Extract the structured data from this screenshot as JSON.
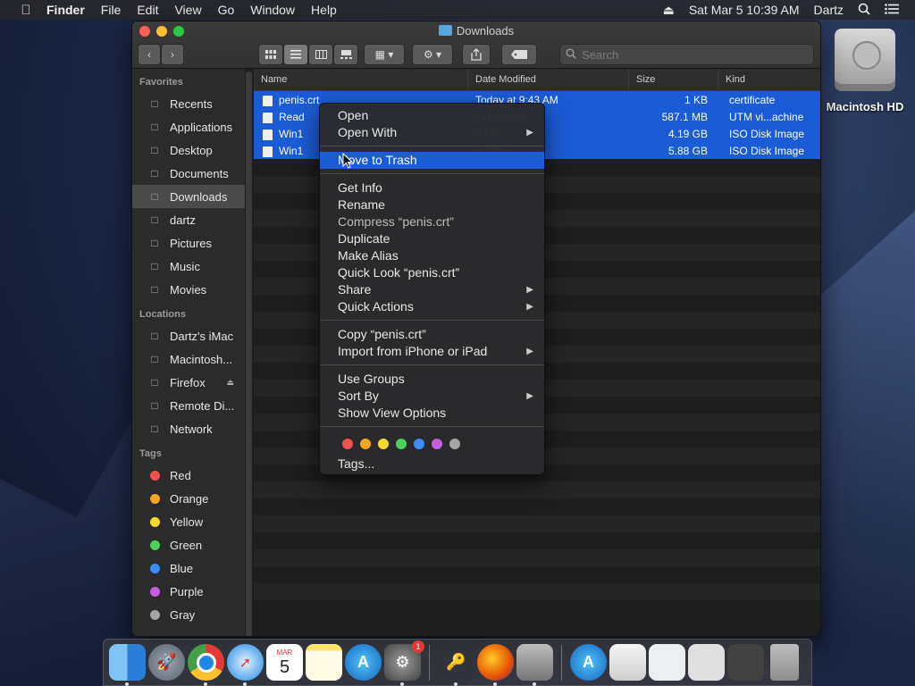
{
  "menubar": {
    "app": "Finder",
    "items": [
      "File",
      "Edit",
      "View",
      "Go",
      "Window",
      "Help"
    ],
    "datetime": "Sat Mar 5  10:39 AM",
    "user": "Dartz"
  },
  "window": {
    "title": "Downloads",
    "search_placeholder": "Search",
    "columns": {
      "name": "Name",
      "date": "Date Modified",
      "size": "Size",
      "kind": "Kind"
    },
    "files": [
      {
        "name": "penis.crt",
        "date": "Today at 9:43 AM",
        "size": "1 KB",
        "kind": "certificate"
      },
      {
        "name": "Read",
        "date": "t 11:13 PM",
        "size": "587.1 MB",
        "kind": "UTM vi...achine"
      },
      {
        "name": "Win1",
        "date": "4 AM",
        "size": "4.19 GB",
        "kind": "ISO Disk Image"
      },
      {
        "name": "Win1",
        "date": "3 AM",
        "size": "5.88 GB",
        "kind": "ISO Disk Image"
      }
    ]
  },
  "sidebar": {
    "favorites_header": "Favorites",
    "favorites": [
      {
        "label": "Recents",
        "icon": "clock-icon"
      },
      {
        "label": "Applications",
        "icon": "applications-icon"
      },
      {
        "label": "Desktop",
        "icon": "desktop-icon"
      },
      {
        "label": "Documents",
        "icon": "documents-icon"
      },
      {
        "label": "Downloads",
        "icon": "downloads-icon"
      },
      {
        "label": "dartz",
        "icon": "home-icon"
      },
      {
        "label": "Pictures",
        "icon": "camera-icon"
      },
      {
        "label": "Music",
        "icon": "music-icon"
      },
      {
        "label": "Movies",
        "icon": "film-icon"
      }
    ],
    "locations_header": "Locations",
    "locations": [
      {
        "label": "Dartz's iMac",
        "icon": "imac-icon"
      },
      {
        "label": "Macintosh...",
        "icon": "disk-icon"
      },
      {
        "label": "Firefox",
        "icon": "disk-icon"
      },
      {
        "label": "Remote Di...",
        "icon": "dvd-icon"
      },
      {
        "label": "Network",
        "icon": "globe-icon"
      }
    ],
    "tags_header": "Tags",
    "tags": [
      {
        "label": "Red",
        "color": "#f0524f"
      },
      {
        "label": "Orange",
        "color": "#f5a623"
      },
      {
        "label": "Yellow",
        "color": "#f8d92f"
      },
      {
        "label": "Green",
        "color": "#4cd158"
      },
      {
        "label": "Blue",
        "color": "#3a8ef6"
      },
      {
        "label": "Purple",
        "color": "#c35fe0"
      },
      {
        "label": "Gray",
        "color": "#a5a5a5"
      }
    ]
  },
  "context_menu": {
    "open": "Open",
    "open_with": "Open With",
    "move_to_trash": "Move to Trash",
    "get_info": "Get Info",
    "rename": "Rename",
    "compress": "Compress “penis.crt”",
    "duplicate": "Duplicate",
    "make_alias": "Make Alias",
    "quick_look": "Quick Look “penis.crt”",
    "share": "Share",
    "quick_actions": "Quick Actions",
    "copy": "Copy “penis.crt”",
    "import": "Import from iPhone or iPad",
    "use_groups": "Use Groups",
    "sort_by": "Sort By",
    "show_view_options": "Show View Options",
    "tag_colors": [
      "#f0524f",
      "#f5a623",
      "#f8d92f",
      "#4cd158",
      "#3a8ef6",
      "#c35fe0",
      "#a5a5a5"
    ],
    "tags": "Tags..."
  },
  "desktop": {
    "hd_label": "Macintosh HD"
  },
  "dock": {
    "calendar_month": "MAR",
    "calendar_day": "5",
    "settings_badge": "1"
  }
}
